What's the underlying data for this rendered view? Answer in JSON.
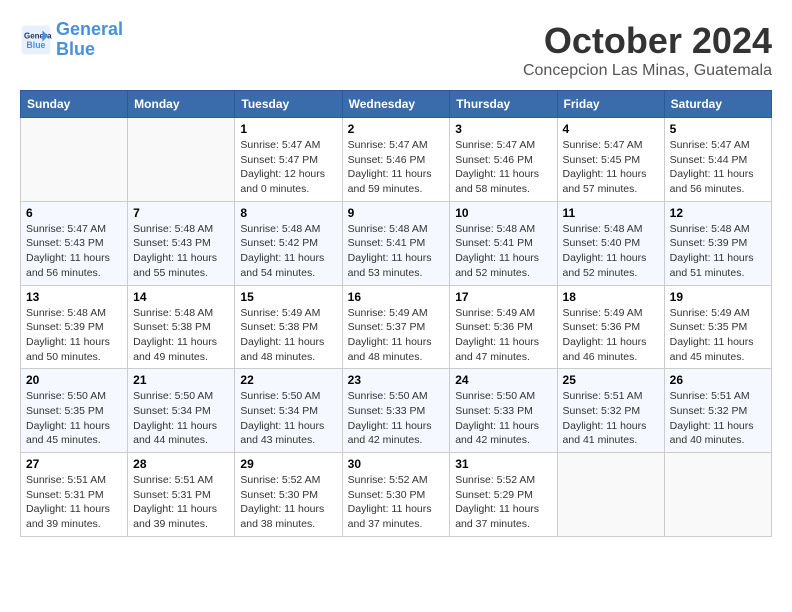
{
  "header": {
    "logo_line1": "General",
    "logo_line2": "Blue",
    "month": "October 2024",
    "location": "Concepcion Las Minas, Guatemala"
  },
  "weekdays": [
    "Sunday",
    "Monday",
    "Tuesday",
    "Wednesday",
    "Thursday",
    "Friday",
    "Saturday"
  ],
  "weeks": [
    [
      {
        "day": "",
        "sunrise": "",
        "sunset": "",
        "daylight": ""
      },
      {
        "day": "",
        "sunrise": "",
        "sunset": "",
        "daylight": ""
      },
      {
        "day": "1",
        "sunrise": "Sunrise: 5:47 AM",
        "sunset": "Sunset: 5:47 PM",
        "daylight": "Daylight: 12 hours and 0 minutes."
      },
      {
        "day": "2",
        "sunrise": "Sunrise: 5:47 AM",
        "sunset": "Sunset: 5:46 PM",
        "daylight": "Daylight: 11 hours and 59 minutes."
      },
      {
        "day": "3",
        "sunrise": "Sunrise: 5:47 AM",
        "sunset": "Sunset: 5:46 PM",
        "daylight": "Daylight: 11 hours and 58 minutes."
      },
      {
        "day": "4",
        "sunrise": "Sunrise: 5:47 AM",
        "sunset": "Sunset: 5:45 PM",
        "daylight": "Daylight: 11 hours and 57 minutes."
      },
      {
        "day": "5",
        "sunrise": "Sunrise: 5:47 AM",
        "sunset": "Sunset: 5:44 PM",
        "daylight": "Daylight: 11 hours and 56 minutes."
      }
    ],
    [
      {
        "day": "6",
        "sunrise": "Sunrise: 5:47 AM",
        "sunset": "Sunset: 5:43 PM",
        "daylight": "Daylight: 11 hours and 56 minutes."
      },
      {
        "day": "7",
        "sunrise": "Sunrise: 5:48 AM",
        "sunset": "Sunset: 5:43 PM",
        "daylight": "Daylight: 11 hours and 55 minutes."
      },
      {
        "day": "8",
        "sunrise": "Sunrise: 5:48 AM",
        "sunset": "Sunset: 5:42 PM",
        "daylight": "Daylight: 11 hours and 54 minutes."
      },
      {
        "day": "9",
        "sunrise": "Sunrise: 5:48 AM",
        "sunset": "Sunset: 5:41 PM",
        "daylight": "Daylight: 11 hours and 53 minutes."
      },
      {
        "day": "10",
        "sunrise": "Sunrise: 5:48 AM",
        "sunset": "Sunset: 5:41 PM",
        "daylight": "Daylight: 11 hours and 52 minutes."
      },
      {
        "day": "11",
        "sunrise": "Sunrise: 5:48 AM",
        "sunset": "Sunset: 5:40 PM",
        "daylight": "Daylight: 11 hours and 52 minutes."
      },
      {
        "day": "12",
        "sunrise": "Sunrise: 5:48 AM",
        "sunset": "Sunset: 5:39 PM",
        "daylight": "Daylight: 11 hours and 51 minutes."
      }
    ],
    [
      {
        "day": "13",
        "sunrise": "Sunrise: 5:48 AM",
        "sunset": "Sunset: 5:39 PM",
        "daylight": "Daylight: 11 hours and 50 minutes."
      },
      {
        "day": "14",
        "sunrise": "Sunrise: 5:48 AM",
        "sunset": "Sunset: 5:38 PM",
        "daylight": "Daylight: 11 hours and 49 minutes."
      },
      {
        "day": "15",
        "sunrise": "Sunrise: 5:49 AM",
        "sunset": "Sunset: 5:38 PM",
        "daylight": "Daylight: 11 hours and 48 minutes."
      },
      {
        "day": "16",
        "sunrise": "Sunrise: 5:49 AM",
        "sunset": "Sunset: 5:37 PM",
        "daylight": "Daylight: 11 hours and 48 minutes."
      },
      {
        "day": "17",
        "sunrise": "Sunrise: 5:49 AM",
        "sunset": "Sunset: 5:36 PM",
        "daylight": "Daylight: 11 hours and 47 minutes."
      },
      {
        "day": "18",
        "sunrise": "Sunrise: 5:49 AM",
        "sunset": "Sunset: 5:36 PM",
        "daylight": "Daylight: 11 hours and 46 minutes."
      },
      {
        "day": "19",
        "sunrise": "Sunrise: 5:49 AM",
        "sunset": "Sunset: 5:35 PM",
        "daylight": "Daylight: 11 hours and 45 minutes."
      }
    ],
    [
      {
        "day": "20",
        "sunrise": "Sunrise: 5:50 AM",
        "sunset": "Sunset: 5:35 PM",
        "daylight": "Daylight: 11 hours and 45 minutes."
      },
      {
        "day": "21",
        "sunrise": "Sunrise: 5:50 AM",
        "sunset": "Sunset: 5:34 PM",
        "daylight": "Daylight: 11 hours and 44 minutes."
      },
      {
        "day": "22",
        "sunrise": "Sunrise: 5:50 AM",
        "sunset": "Sunset: 5:34 PM",
        "daylight": "Daylight: 11 hours and 43 minutes."
      },
      {
        "day": "23",
        "sunrise": "Sunrise: 5:50 AM",
        "sunset": "Sunset: 5:33 PM",
        "daylight": "Daylight: 11 hours and 42 minutes."
      },
      {
        "day": "24",
        "sunrise": "Sunrise: 5:50 AM",
        "sunset": "Sunset: 5:33 PM",
        "daylight": "Daylight: 11 hours and 42 minutes."
      },
      {
        "day": "25",
        "sunrise": "Sunrise: 5:51 AM",
        "sunset": "Sunset: 5:32 PM",
        "daylight": "Daylight: 11 hours and 41 minutes."
      },
      {
        "day": "26",
        "sunrise": "Sunrise: 5:51 AM",
        "sunset": "Sunset: 5:32 PM",
        "daylight": "Daylight: 11 hours and 40 minutes."
      }
    ],
    [
      {
        "day": "27",
        "sunrise": "Sunrise: 5:51 AM",
        "sunset": "Sunset: 5:31 PM",
        "daylight": "Daylight: 11 hours and 39 minutes."
      },
      {
        "day": "28",
        "sunrise": "Sunrise: 5:51 AM",
        "sunset": "Sunset: 5:31 PM",
        "daylight": "Daylight: 11 hours and 39 minutes."
      },
      {
        "day": "29",
        "sunrise": "Sunrise: 5:52 AM",
        "sunset": "Sunset: 5:30 PM",
        "daylight": "Daylight: 11 hours and 38 minutes."
      },
      {
        "day": "30",
        "sunrise": "Sunrise: 5:52 AM",
        "sunset": "Sunset: 5:30 PM",
        "daylight": "Daylight: 11 hours and 37 minutes."
      },
      {
        "day": "31",
        "sunrise": "Sunrise: 5:52 AM",
        "sunset": "Sunset: 5:29 PM",
        "daylight": "Daylight: 11 hours and 37 minutes."
      },
      {
        "day": "",
        "sunrise": "",
        "sunset": "",
        "daylight": ""
      },
      {
        "day": "",
        "sunrise": "",
        "sunset": "",
        "daylight": ""
      }
    ]
  ]
}
